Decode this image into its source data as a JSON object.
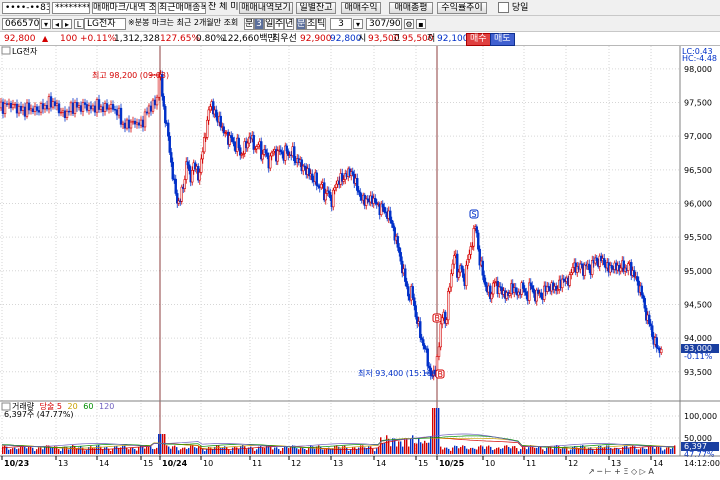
{
  "toolbar1": {
    "account": "••••-••83",
    "password": "********",
    "tab_trade_mark": "매매마크/내역 조회",
    "tab_recent_items": "최근매매종목",
    "fill_label": "잔 체 미",
    "trade_history": "매매내역보기",
    "daily_balance": "일별잔고",
    "trade_profit": "매매수익",
    "trade_total": "매매총평",
    "profit_trend": "수익률추이",
    "today": "당일"
  },
  "toolbar2": {
    "code": "066570",
    "stock_name": "LG전자",
    "notice": "※분봉 마크는 최근 2개월만 조회",
    "periods": [
      "분",
      "3",
      "일",
      "주",
      "년",
      "분",
      "초",
      "틱"
    ],
    "interval": "3",
    "page_count": "307/900"
  },
  "quote": {
    "last": "92,800",
    "dir": "▲",
    "change": "100",
    "pct": "+0.11%",
    "vol": "1,312,328",
    "vol_ratio": "127.65%",
    "turnover_ratio": "0.80%",
    "amount": "122,660백만",
    "best_ask_label": "최우선",
    "best_ask": "92,900",
    "best_bid": "92,800",
    "open_label": "시",
    "open": "93,500",
    "high_label": "고",
    "high": "95,500",
    "low_label": "저",
    "low": "92,100",
    "buy": "매수",
    "sell": "매도"
  },
  "chart_labels": {
    "legend": "LG전자",
    "lc": "LC:0.43",
    "hc": "HC:-4.48",
    "high_ann": "최고 98,200 (09:03)",
    "low_ann": "최저 93,400 (15:18)",
    "marker_s": "S",
    "marker_b": "B",
    "price_tag": "93,000",
    "price_tag_pct": "-0.11%",
    "vol_legend_prefix": "거래량",
    "vol_legend_items": [
      "당술 5",
      "20",
      "60",
      "120"
    ],
    "vol_value": "6,397주 (47.77%)",
    "vol_tag": "6,397",
    "vol_tag2": "47.77%",
    "time_end": "14:12:00",
    "footer_tools": "↗ ─ ⊢ + Ξ ◇ ▷ A"
  },
  "chart_data": {
    "type": "candlestick",
    "price_axis": [
      "98,000",
      "97,500",
      "97,000",
      "96,500",
      "96,000",
      "95,500",
      "95,000",
      "94,500",
      "94,000",
      "93,500"
    ],
    "ylim": [
      93200,
      98250
    ],
    "volume_axis": [
      "100,000",
      "50,000"
    ],
    "time_axis": [
      "10/23",
      "13",
      "14",
      "15",
      "10/24",
      "10",
      "11",
      "12",
      "13",
      "14",
      "15",
      "10/25",
      "10",
      "11",
      "12",
      "13",
      "14"
    ],
    "day_separators": [
      "10/24",
      "10/25"
    ],
    "high": 98200,
    "low": 93400,
    "price_path": [
      [
        0,
        97420
      ],
      [
        4,
        97430
      ],
      [
        8,
        97480
      ],
      [
        12,
        97460
      ],
      [
        16,
        97420
      ],
      [
        20,
        97400
      ],
      [
        24,
        97380
      ],
      [
        28,
        97420
      ],
      [
        32,
        97400
      ],
      [
        36,
        97380
      ],
      [
        40,
        97420
      ],
      [
        44,
        97430
      ],
      [
        48,
        97480
      ],
      [
        52,
        97510
      ],
      [
        56,
        97450
      ],
      [
        60,
        97380
      ],
      [
        64,
        97300
      ],
      [
        68,
        97380
      ],
      [
        72,
        97430
      ],
      [
        76,
        97450
      ],
      [
        80,
        97420
      ],
      [
        84,
        97460
      ],
      [
        88,
        97430
      ],
      [
        92,
        97400
      ],
      [
        96,
        97460
      ],
      [
        100,
        97430
      ],
      [
        104,
        97400
      ],
      [
        108,
        97450
      ],
      [
        112,
        97420
      ],
      [
        116,
        97380
      ],
      [
        120,
        97300
      ],
      [
        124,
        97120
      ],
      [
        128,
        97200
      ],
      [
        132,
        97180
      ],
      [
        136,
        97220
      ],
      [
        140,
        97150
      ],
      [
        144,
        97260
      ],
      [
        148,
        97400
      ],
      [
        152,
        97460
      ],
      [
        156,
        97480
      ],
      [
        160,
        98000
      ],
      [
        163,
        97500
      ],
      [
        166,
        97200
      ],
      [
        169,
        96900
      ],
      [
        172,
        96500
      ],
      [
        175,
        96200
      ],
      [
        178,
        96000
      ],
      [
        181,
        96100
      ],
      [
        184,
        96300
      ],
      [
        187,
        96700
      ],
      [
        190,
        96300
      ],
      [
        193,
        96600
      ],
      [
        196,
        96500
      ],
      [
        199,
        96400
      ],
      [
        202,
        96700
      ],
      [
        205,
        97000
      ],
      [
        208,
        97300
      ],
      [
        211,
        97500
      ],
      [
        214,
        97400
      ],
      [
        217,
        97200
      ],
      [
        220,
        97300
      ],
      [
        223,
        97000
      ],
      [
        226,
        97100
      ],
      [
        229,
        96900
      ],
      [
        232,
        97000
      ],
      [
        235,
        96800
      ],
      [
        238,
        96900
      ],
      [
        241,
        96700
      ],
      [
        244,
        96800
      ],
      [
        247,
        96900
      ],
      [
        250,
        97000
      ],
      [
        253,
        96900
      ],
      [
        256,
        96800
      ],
      [
        259,
        96900
      ],
      [
        262,
        96700
      ],
      [
        265,
        96800
      ],
      [
        268,
        96600
      ],
      [
        271,
        96700
      ],
      [
        274,
        96800
      ],
      [
        277,
        96700
      ],
      [
        280,
        96800
      ],
      [
        283,
        96700
      ],
      [
        286,
        96800
      ],
      [
        289,
        96700
      ],
      [
        292,
        96800
      ],
      [
        295,
        96600
      ],
      [
        298,
        96700
      ],
      [
        301,
        96500
      ],
      [
        304,
        96600
      ],
      [
        307,
        96400
      ],
      [
        310,
        96500
      ],
      [
        313,
        96300
      ],
      [
        316,
        96400
      ],
      [
        319,
        96200
      ],
      [
        322,
        96300
      ],
      [
        325,
        96100
      ],
      [
        328,
        96200
      ],
      [
        331,
        96000
      ],
      [
        334,
        96200
      ],
      [
        337,
        96300
      ],
      [
        340,
        96400
      ],
      [
        343,
        96300
      ],
      [
        346,
        96500
      ],
      [
        349,
        96400
      ],
      [
        352,
        96500
      ],
      [
        355,
        96300
      ],
      [
        358,
        96200
      ],
      [
        361,
        96100
      ],
      [
        364,
        96000
      ],
      [
        367,
        96100
      ],
      [
        370,
        96000
      ],
      [
        373,
        96100
      ],
      [
        376,
        96000
      ],
      [
        379,
        95900
      ],
      [
        382,
        96000
      ],
      [
        385,
        95800
      ],
      [
        388,
        95900
      ],
      [
        391,
        95700
      ],
      [
        394,
        95600
      ],
      [
        397,
        95400
      ],
      [
        400,
        95200
      ],
      [
        403,
        95000
      ],
      [
        406,
        94800
      ],
      [
        409,
        94600
      ],
      [
        412,
        94700
      ],
      [
        415,
        94400
      ],
      [
        418,
        94200
      ],
      [
        421,
        94000
      ],
      [
        424,
        93900
      ],
      [
        427,
        93700
      ],
      [
        430,
        93500
      ],
      [
        433,
        93400
      ],
      [
        436,
        93600
      ],
      [
        440,
        94000
      ],
      [
        443,
        94500
      ],
      [
        446,
        94100
      ],
      [
        449,
        94800
      ],
      [
        452,
        95000
      ],
      [
        455,
        95300
      ],
      [
        458,
        94900
      ],
      [
        461,
        95100
      ],
      [
        464,
        94800
      ],
      [
        467,
        95100
      ],
      [
        470,
        95300
      ],
      [
        473,
        95500
      ],
      [
        476,
        95700
      ],
      [
        479,
        95200
      ],
      [
        482,
        95000
      ],
      [
        485,
        94800
      ],
      [
        488,
        94700
      ],
      [
        491,
        94600
      ],
      [
        494,
        94900
      ],
      [
        497,
        94700
      ],
      [
        500,
        94800
      ],
      [
        503,
        94600
      ],
      [
        506,
        94700
      ],
      [
        509,
        94600
      ],
      [
        512,
        94800
      ],
      [
        515,
        94700
      ],
      [
        518,
        94600
      ],
      [
        521,
        94800
      ],
      [
        524,
        94700
      ],
      [
        527,
        94600
      ],
      [
        530,
        94800
      ],
      [
        533,
        94700
      ],
      [
        536,
        94600
      ],
      [
        539,
        94700
      ],
      [
        542,
        94600
      ],
      [
        545,
        94700
      ],
      [
        548,
        94800
      ],
      [
        551,
        94700
      ],
      [
        554,
        94800
      ],
      [
        557,
        94700
      ],
      [
        560,
        94800
      ],
      [
        563,
        94900
      ],
      [
        566,
        94800
      ],
      [
        569,
        94900
      ],
      [
        572,
        95000
      ],
      [
        575,
        95100
      ],
      [
        578,
        95000
      ],
      [
        581,
        95100
      ],
      [
        584,
        95000
      ],
      [
        587,
        95100
      ],
      [
        590,
        95000
      ],
      [
        593,
        95100
      ],
      [
        596,
        95200
      ],
      [
        599,
        95100
      ],
      [
        602,
        95200
      ],
      [
        605,
        95100
      ],
      [
        608,
        95000
      ],
      [
        611,
        95100
      ],
      [
        614,
        95000
      ],
      [
        617,
        95100
      ],
      [
        620,
        95000
      ],
      [
        623,
        95100
      ],
      [
        626,
        95000
      ],
      [
        629,
        95100
      ],
      [
        632,
        95000
      ],
      [
        635,
        94900
      ],
      [
        638,
        94800
      ],
      [
        641,
        94700
      ],
      [
        644,
        94500
      ],
      [
        647,
        94300
      ],
      [
        650,
        94200
      ],
      [
        653,
        94000
      ],
      [
        656,
        93900
      ],
      [
        659,
        93800
      ],
      [
        662,
        93900
      ]
    ],
    "markers": [
      {
        "type": "S",
        "value": 95700
      },
      {
        "type": "B",
        "value": 94000
      },
      {
        "type": "B",
        "value": 93400
      }
    ]
  },
  "colors": {
    "up": "#d40000",
    "down": "#0030c8",
    "grid": "#d6d6d6",
    "sep": "#8c3c3c",
    "price_tag": "#1a3fa0"
  }
}
